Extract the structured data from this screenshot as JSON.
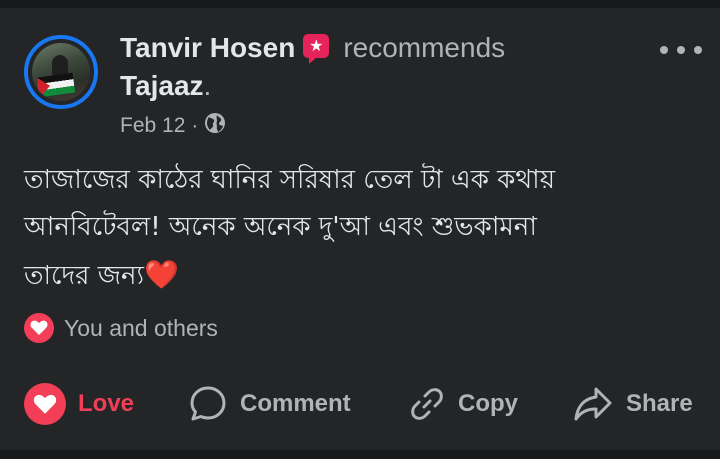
{
  "post": {
    "author": "Tanvir Hosen",
    "recommend_icon": "recommend-star-icon",
    "verb": "recommends",
    "page_name": "Tajaaz",
    "page_suffix": ".",
    "date": "Feb 12",
    "separator": "·",
    "audience_icon": "globe-icon",
    "more_icon": "more-options-icon",
    "body_lines": [
      "তাজাজের কাঠের ঘানির সরিষার তেল টা এক কথায়",
      "আনবিটেবল! অনেক অনেক দু'আ এবং শুভকামনা",
      "তাদের জন্য"
    ],
    "body_emoji": "❤️"
  },
  "reactions": {
    "icon": "love-reaction-icon",
    "text": "You and others"
  },
  "actions": {
    "love": "Love",
    "comment": "Comment",
    "copy": "Copy",
    "share": "Share"
  },
  "colors": {
    "background": "#242526",
    "text": "#e4e6eb",
    "secondary": "#b0b3b8",
    "love": "#f33e58",
    "avatar_ring": "#1877f2"
  }
}
